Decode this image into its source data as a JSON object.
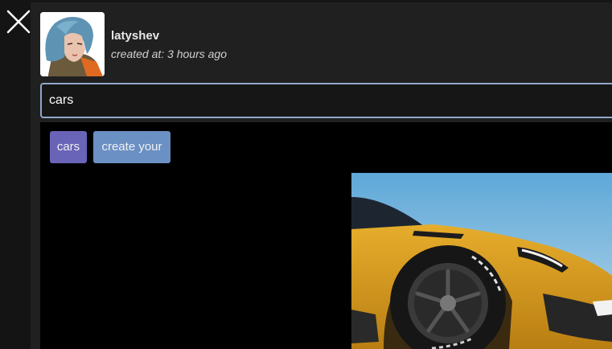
{
  "post": {
    "username": "latyshev",
    "created_at": "created at: 3 hours ago"
  },
  "search": {
    "value": "cars"
  },
  "tags": [
    {
      "label": "cars",
      "color": "#6a64b8"
    },
    {
      "label": "create your",
      "color": "#6a90c4"
    }
  ],
  "icons": {
    "close": "close-icon",
    "avatar": "anime-girl-avatar",
    "image": "yellow-sports-car-photo"
  },
  "colors": {
    "background": "#141414",
    "panel": "#202020",
    "content": "#000000",
    "input_border": "#8fa8c8"
  }
}
